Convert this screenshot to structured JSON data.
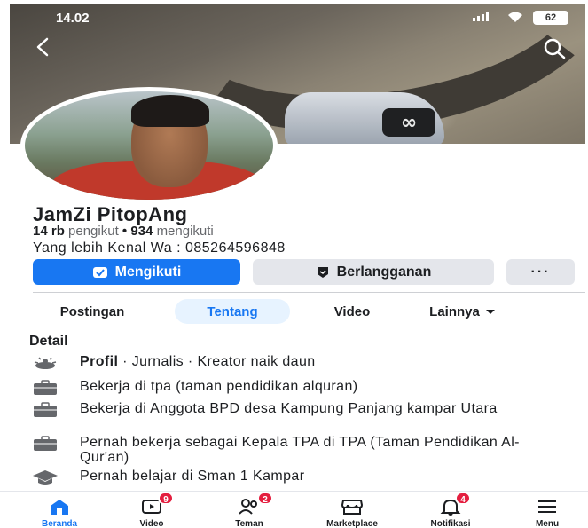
{
  "status_bar": {
    "time": "14.02",
    "battery": "62"
  },
  "profile": {
    "name": "JamZi PitopAng",
    "followers_count": "14 rb",
    "followers_label": "pengikut",
    "separator": "•",
    "following_count": "934",
    "following_label": "mengikuti",
    "bio": "Yang lebih Kenal Wa : 085264596848"
  },
  "actions": {
    "follow_label": "Mengikuti",
    "subscribe_label": "Berlangganan",
    "more_label": "···"
  },
  "tabs": [
    {
      "label": "Postingan",
      "active": false
    },
    {
      "label": "Tentang",
      "active": true
    },
    {
      "label": "Video",
      "active": false
    },
    {
      "label": "Lainnya",
      "active": false
    }
  ],
  "details": {
    "title": "Detail",
    "items": [
      {
        "icon": "info-icon",
        "bold": "Profil",
        "text": " · Jurnalis · Kreator naik daun"
      },
      {
        "icon": "briefcase-icon",
        "bold": "",
        "text": "Bekerja di tpa (taman pendidikan alquran)"
      },
      {
        "icon": "briefcase-icon",
        "bold": "",
        "text": "Bekerja di Anggota BPD desa Kampung Panjang kampar Utara"
      },
      {
        "icon": "briefcase-icon",
        "bold": "",
        "text": "Pernah bekerja sebagai  Kepala TPA di TPA (Taman Pendidikan Al-Qur'an)"
      },
      {
        "icon": "graduation-cap-icon",
        "bold": "",
        "text": "Pernah belajar di Sman 1 Kampar"
      }
    ]
  },
  "navbar": [
    {
      "label": "Beranda",
      "icon": "home-icon",
      "badge": "",
      "active": true
    },
    {
      "label": "Video",
      "icon": "video-icon",
      "badge": "9",
      "active": false
    },
    {
      "label": "Teman",
      "icon": "friends-icon",
      "badge": "2",
      "active": false
    },
    {
      "label": "Marketplace",
      "icon": "marketplace-icon",
      "badge": "",
      "active": false
    },
    {
      "label": "Notifikasi",
      "icon": "bell-icon",
      "badge": "4",
      "active": false
    },
    {
      "label": "Menu",
      "icon": "hamburger-icon",
      "badge": "",
      "active": false
    }
  ],
  "colors": {
    "accent": "#1877f2",
    "badge": "#e41e3f",
    "button_gray": "#e4e6eb"
  }
}
